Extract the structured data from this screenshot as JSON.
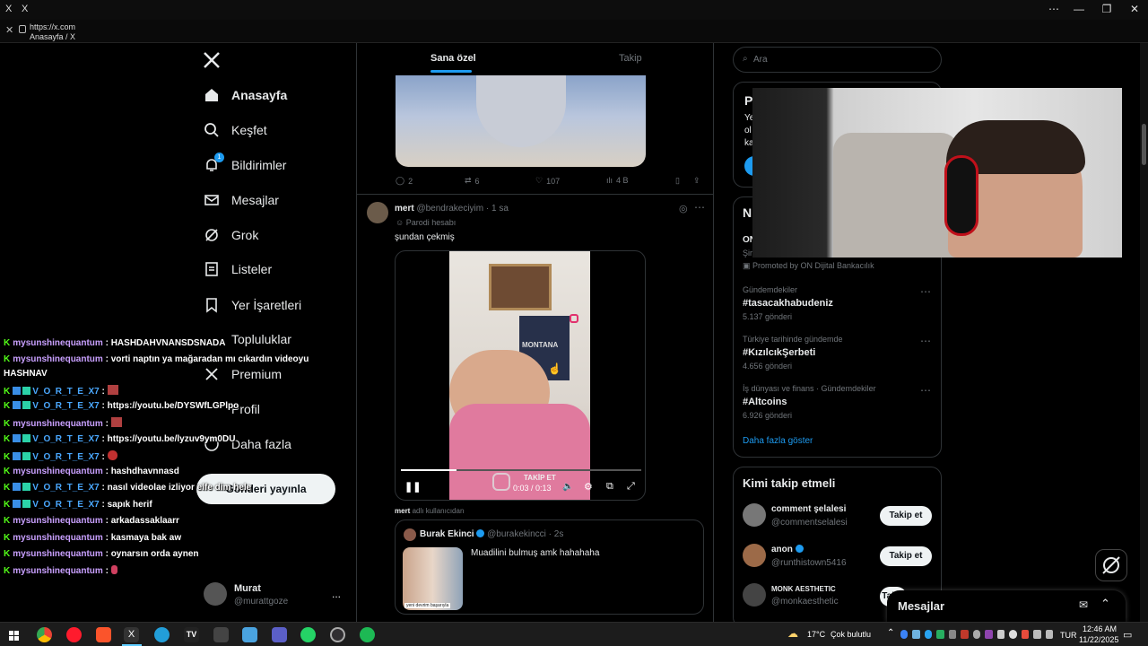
{
  "browser": {
    "tab_icon": "X",
    "tab_title": "X",
    "url": "https://x.com",
    "page_title": "Anasayfa / X",
    "win_controls": [
      "⋯",
      "—",
      "❐",
      "✕"
    ]
  },
  "nav": {
    "logo": "X",
    "items": [
      {
        "label": "Anasayfa",
        "icon": "home-icon"
      },
      {
        "label": "Keşfet",
        "icon": "search-icon"
      },
      {
        "label": "Bildirimler",
        "icon": "bell-icon",
        "badge": "1"
      },
      {
        "label": "Mesajlar",
        "icon": "mail-icon"
      },
      {
        "label": "Grok",
        "icon": "grok-icon"
      },
      {
        "label": "Listeler",
        "icon": "list-icon"
      },
      {
        "label": "Yer İşaretleri",
        "icon": "bookmark-icon"
      },
      {
        "label": "Topluluklar",
        "icon": "communities-icon"
      },
      {
        "label": "Premium",
        "icon": "x-icon"
      },
      {
        "label": "Profil",
        "icon": "profile-icon"
      },
      {
        "label": "Daha fazla",
        "icon": "more-icon"
      }
    ],
    "post_button": "Gönderi yayınla",
    "account": {
      "name": "Murat",
      "handle": "@murattgoze",
      "more": "..."
    }
  },
  "timeline": {
    "tabs": [
      "Sana özel",
      "Takip"
    ],
    "prev_post_stats": {
      "replies": "2",
      "reposts": "6",
      "likes": "107",
      "views": "4 B"
    },
    "post": {
      "author": "mert",
      "handle": "@bendrakeciyim",
      "time": "1 sa",
      "parody": "Parodi hesabı",
      "text": "şundan çekmiş",
      "video_time": "0:03 / 0:13",
      "video_overlay": "TAKİP ET",
      "poster_text": "MONTANA",
      "footer_user": "mert",
      "footer_suffix": "adlı kullanıcıdan"
    },
    "quote": {
      "author": "Burak Ekinci",
      "handle": "@burakekincci",
      "time": "2s",
      "text": "Muadilini bulmuş amk hahahaha",
      "image_caption": "yeni devrim başarıyla"
    }
  },
  "right": {
    "search_placeholder": "Ara",
    "premium_card": {
      "title": "P",
      "lines": [
        "Ye",
        "ol",
        "ka"
      ]
    },
    "trends_card": {
      "title": "N",
      "promo_partial": "ON",
      "promo_line": "Şir"
    },
    "promoted": "Promoted by ON Dijital Bankacılık",
    "trends": [
      {
        "category": "Gündemdekiler",
        "name": "#tasacakhabudeniz",
        "count": "5.137 gönderi"
      },
      {
        "category": "Türkiye tarihinde gündemde",
        "name": "#KızılcıkŞerbeti",
        "count": "4.656 gönderi"
      },
      {
        "category": "İş dünyası ve finans · Gündemdekiler",
        "name": "#Altcoins",
        "count": "6.926 gönderi"
      }
    ],
    "show_more": "Daha fazla göster",
    "who_to_follow": "Kimi takip etmeli",
    "suggestions": [
      {
        "name": "comment şelalesi",
        "handle": "@commentselalesi",
        "button": "Takip et"
      },
      {
        "name": "anon",
        "handle": "@runthistown5416",
        "button": "Takip et"
      },
      {
        "name": "MONK AESTHETIC",
        "handle": "@monkaesthetic",
        "button": "Takip et"
      }
    ],
    "messages_drawer": "Mesajlar"
  },
  "chat": [
    {
      "user": "mysunshinequantum",
      "text": "HASHDAHVNANSDSNADA",
      "style": "u1"
    },
    {
      "user": "mysunshinequantum",
      "text": "vorti naptın ya mağaradan mı cıkardın videoyu",
      "style": "u1"
    },
    {
      "user": "",
      "text": "HASHNAV",
      "style": "u1"
    },
    {
      "user": "V_O_R_T_E_X7",
      "text": "",
      "style": "u2"
    },
    {
      "user": "V_O_R_T_E_X7",
      "text": "https://youtu.be/DYSWfLGPlpo",
      "style": "u2"
    },
    {
      "user": "mysunshinequantum",
      "text": "",
      "style": "u1"
    },
    {
      "user": "V_O_R_T_E_X7",
      "text": "https://youtu.be/lyzuv9ym0DU",
      "style": "u2"
    },
    {
      "user": "V_O_R_T_E_X7",
      "text": "",
      "style": "u2"
    },
    {
      "user": "mysunshinequantum",
      "text": "hashdhavnnasd",
      "style": "u1"
    },
    {
      "user": "V_O_R_T_E_X7",
      "text": "nasıl videolae izliyor elfe dim hele",
      "style": "u2"
    },
    {
      "user": "V_O_R_T_E_X7",
      "text": "sapık herif",
      "style": "u2"
    },
    {
      "user": "mysunshinequantum",
      "text": "arkadassaklaarr",
      "style": "u1"
    },
    {
      "user": "mysunshinequantum",
      "text": "kasmaya bak aw",
      "style": "u1"
    },
    {
      "user": "mysunshinequantum",
      "text": "oynarsın orda aynen",
      "style": "u1"
    },
    {
      "user": "mysunshinequantum",
      "text": "",
      "style": "u1"
    }
  ],
  "taskbar": {
    "weather": "17°C",
    "weather_text": "Çok bulutlu",
    "lang": "TUR",
    "time": "12:46 AM",
    "date": "11/22/2025"
  },
  "colors": {
    "accent": "#1d9bf0",
    "bg": "#000000",
    "border": "#2f3336",
    "kick": "#53fc18"
  }
}
